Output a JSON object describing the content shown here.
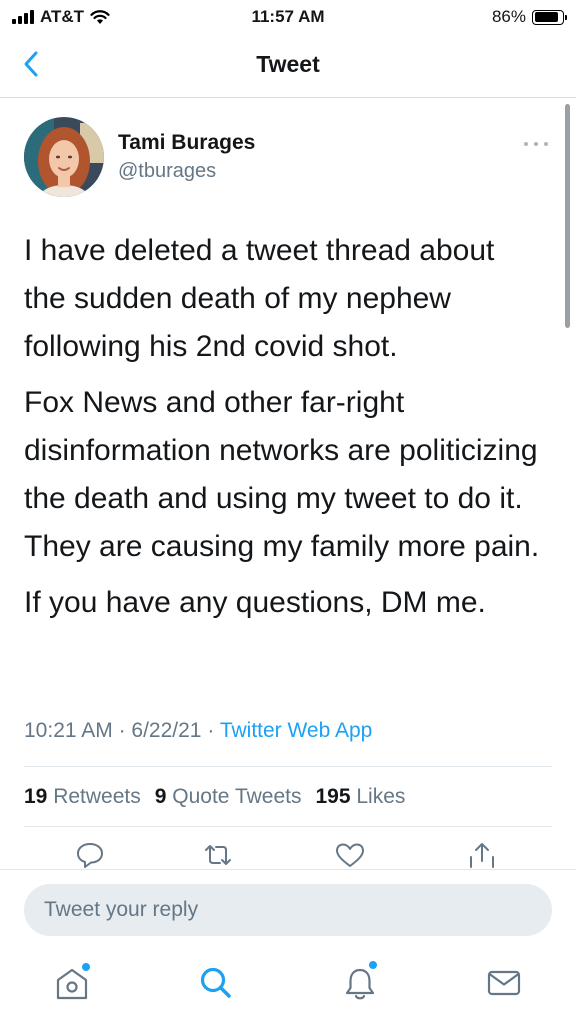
{
  "status_bar": {
    "carrier": "AT&T",
    "time": "11:57 AM",
    "battery_percent": "86%",
    "battery_level": 0.86
  },
  "nav": {
    "title": "Tweet",
    "back_icon": "chevron-left-icon"
  },
  "tweet": {
    "author": {
      "name": "Tami Burages",
      "handle": "@tburages"
    },
    "paragraphs": [
      "I have deleted a tweet thread about the sudden death of my nephew following his 2nd covid shot.",
      "Fox News and other far-right disinformation networks are politicizing the death and using my tweet to do it. They are causing my family more pain.",
      "If you have any questions, DM me."
    ],
    "time": "10:21 AM",
    "date": "6/22/21",
    "separator": "·",
    "source": "Twitter Web App",
    "stats": {
      "retweets_count": "19",
      "retweets_label": "Retweets",
      "quotes_count": "9",
      "quotes_label": "Quote Tweets",
      "likes_count": "195",
      "likes_label": "Likes"
    },
    "actions": [
      "reply-icon",
      "retweet-icon",
      "like-icon",
      "share-icon"
    ]
  },
  "reply": {
    "placeholder": "Tweet your reply"
  },
  "tab_bar": {
    "items": [
      "home-icon",
      "search-icon",
      "notifications-icon",
      "messages-icon"
    ]
  },
  "colors": {
    "accent": "#1da1f2",
    "secondary_text": "#657786",
    "primary_text": "#14171a"
  }
}
